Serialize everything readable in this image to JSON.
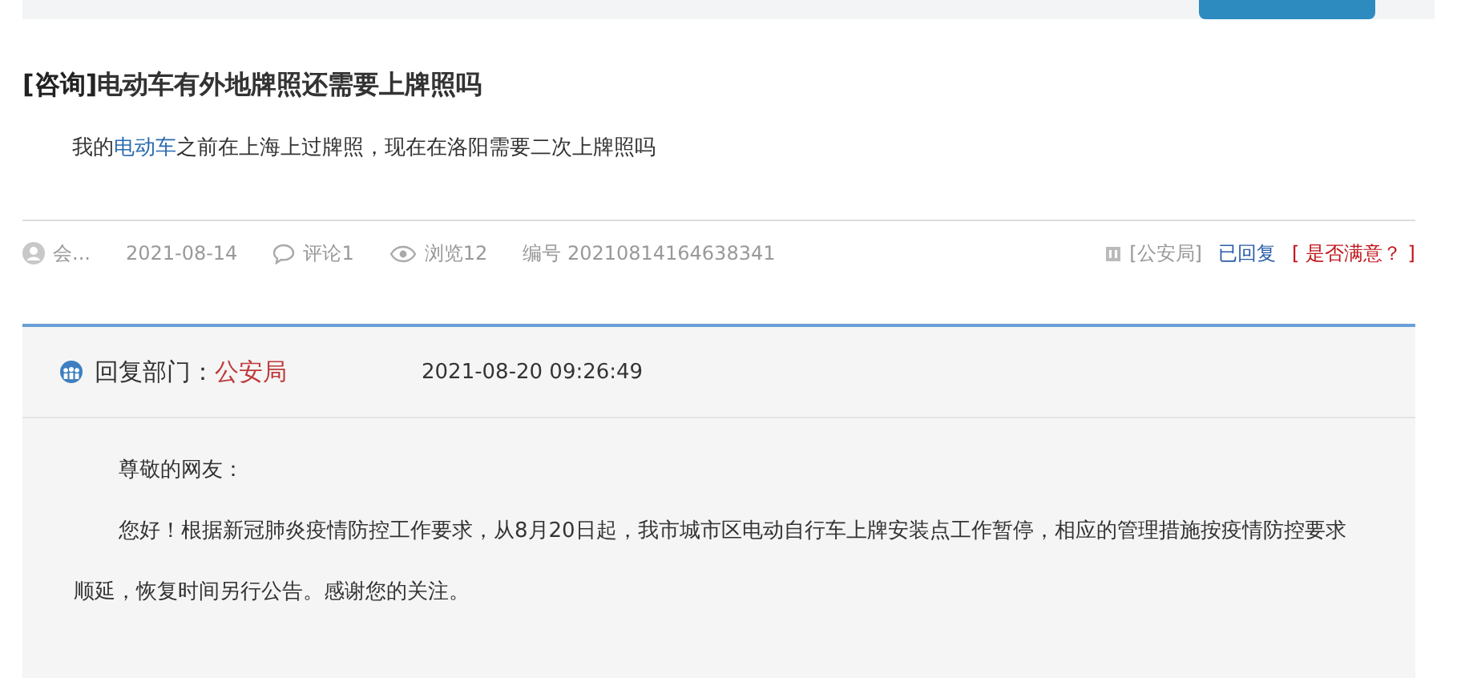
{
  "question": {
    "tag": "[咨询]",
    "title": "电动车有外地牌照还需要上牌照吗",
    "body_before": "我的",
    "body_link": "电动车",
    "body_after": "之前在上海上过牌照，现在在洛阳需要二次上牌照吗"
  },
  "meta": {
    "author": "会...",
    "date": "2021-08-14",
    "comments": "评论1",
    "views": "浏览12",
    "number": "编号 20210814164638341",
    "department": "[公安局]",
    "status": "已回复",
    "satisfaction": "[ 是否满意？ ]"
  },
  "reply": {
    "label": "回复部门：",
    "department": "公安局",
    "time": "2021-08-20 09:26:49",
    "paragraphs": [
      "尊敬的网友：",
      "您好！根据新冠肺炎疫情防控工作要求，从8月20日起，我市城市区电动自行车上牌安装点工作暂停，相应的管理措施按疫情防控要求顺延，恢复时间另行公告。感谢您的关注。"
    ]
  }
}
